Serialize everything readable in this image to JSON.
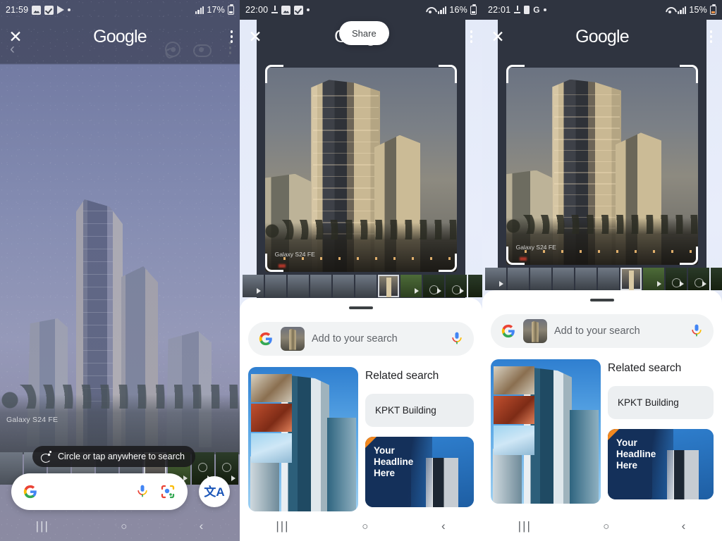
{
  "panels": [
    {
      "id": "panel-1",
      "status": {
        "time": "21:59",
        "icons": [
          "photos-icon",
          "tasks-icon",
          "play-icon",
          "dot-icon"
        ],
        "signal": "signal-icon",
        "battery_text": "17%"
      },
      "header": {
        "title": "Google",
        "close_label": "✕",
        "menu_label": "more-options"
      },
      "subheader": {
        "back_label": "‹",
        "icons": [
          "lens-icon",
          "eye-icon",
          "kebab-icon"
        ]
      },
      "photo": {
        "watermark": "Galaxy S24 FE"
      },
      "hint_pill": {
        "icon": "circle-search-icon",
        "text": "Circle or tap anywhere to search"
      },
      "search_bar": {
        "logo": "google-g-icon",
        "value": "",
        "placeholder": "",
        "mic": "microphone-icon",
        "lens": "google-lens-icon"
      },
      "translate_button": {
        "icon": "translate-icon",
        "label": "文A"
      },
      "nav": {
        "recent": "|||",
        "home": "○",
        "back": "‹"
      }
    },
    {
      "id": "panel-2",
      "status": {
        "time": "22:00",
        "icons": [
          "download-icon",
          "photos-icon",
          "tasks-icon",
          "dot-icon"
        ],
        "wifi": "wifi-icon",
        "signal": "signal-icon",
        "battery_text": "16%"
      },
      "header": {
        "title": "Google",
        "close_label": "✕",
        "menu_label": "more-options"
      },
      "tooltip": {
        "text": "Share"
      },
      "photo": {
        "watermark": "Galaxy S24 FE"
      },
      "sheet": {
        "add_bar": {
          "logo": "google-g-icon",
          "thumb": "crop-thumbnail",
          "placeholder": "Add to your search",
          "mic": "microphone-icon"
        },
        "related_title": "Related search",
        "chips": [
          "KPKT Building"
        ],
        "ad": {
          "headline_lines": [
            "Your",
            "Headline",
            "Here"
          ]
        }
      },
      "nav": {
        "recent": "|||",
        "home": "○",
        "back": "‹"
      }
    },
    {
      "id": "panel-3",
      "status": {
        "time": "22:01",
        "icons": [
          "download-icon",
          "battery-saver-icon",
          "google-icon",
          "dot-icon"
        ],
        "wifi": "wifi-icon",
        "signal": "signal-icon",
        "battery_text": "15%"
      },
      "header": {
        "title": "Google",
        "close_label": "✕",
        "menu_label": "more-options"
      },
      "photo": {
        "watermark": "Galaxy S24 FE"
      },
      "sheet": {
        "add_bar": {
          "logo": "google-g-icon",
          "thumb": "crop-thumbnail",
          "placeholder": "Add to your search",
          "mic": "microphone-icon"
        },
        "related_title": "Related search",
        "chips": [
          "KPKT Building"
        ],
        "ad": {
          "headline_lines": [
            "Your",
            "Headline",
            "Here"
          ]
        }
      },
      "nav": {
        "recent": "|||",
        "home": "○",
        "back": "‹"
      }
    }
  ],
  "colors": {
    "google_blue": "#4285F4",
    "google_red": "#EA4335",
    "google_yellow": "#FBBC05",
    "google_green": "#34A853",
    "lens_bg": "#e3e9f8",
    "sheet_bg": "#ffffff",
    "chip_bg": "#eceff1"
  }
}
